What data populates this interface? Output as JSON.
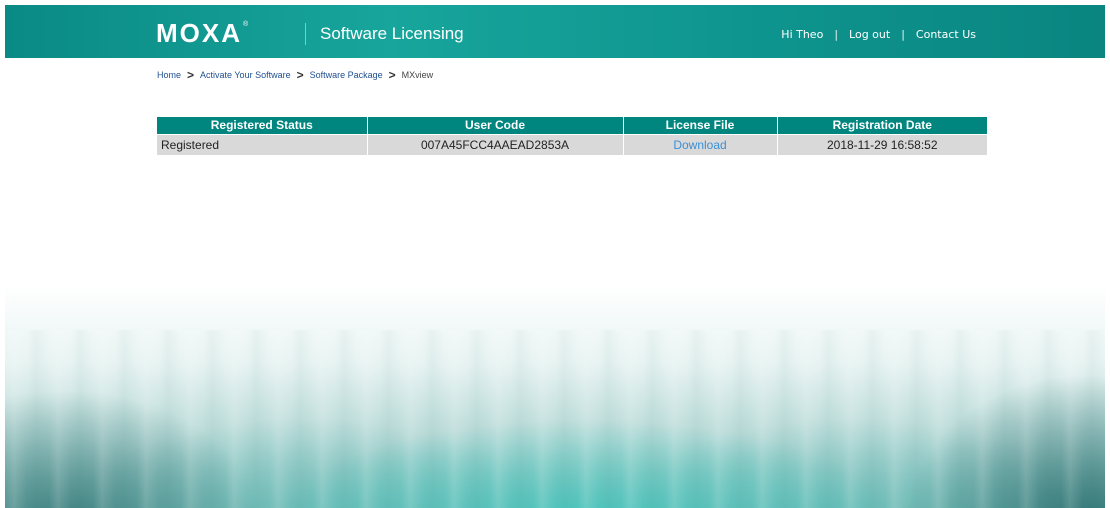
{
  "header": {
    "logo_text": "MOXA",
    "logo_mark": "®",
    "app_title": "Software Licensing",
    "greeting": "Hi Theo",
    "logout_label": "Log out",
    "contact_label": "Contact Us",
    "separator": "|",
    "background_color": "#0f9690"
  },
  "breadcrumb": {
    "separator": ">",
    "items": [
      {
        "label": "Home"
      },
      {
        "label": "Activate Your Software"
      },
      {
        "label": "Software Package"
      }
    ],
    "current": "MXview"
  },
  "table": {
    "header_color": "#00857f",
    "row_color": "#d9d9d9",
    "columns": [
      "Registered Status",
      "User Code",
      "License File",
      "Registration Date"
    ],
    "rows": [
      {
        "status": "Registered",
        "user_code": "007A45FCC4AAEAD2853A",
        "license_file": "Download",
        "registration_date": "2018-11-29 16:58:52"
      }
    ]
  }
}
